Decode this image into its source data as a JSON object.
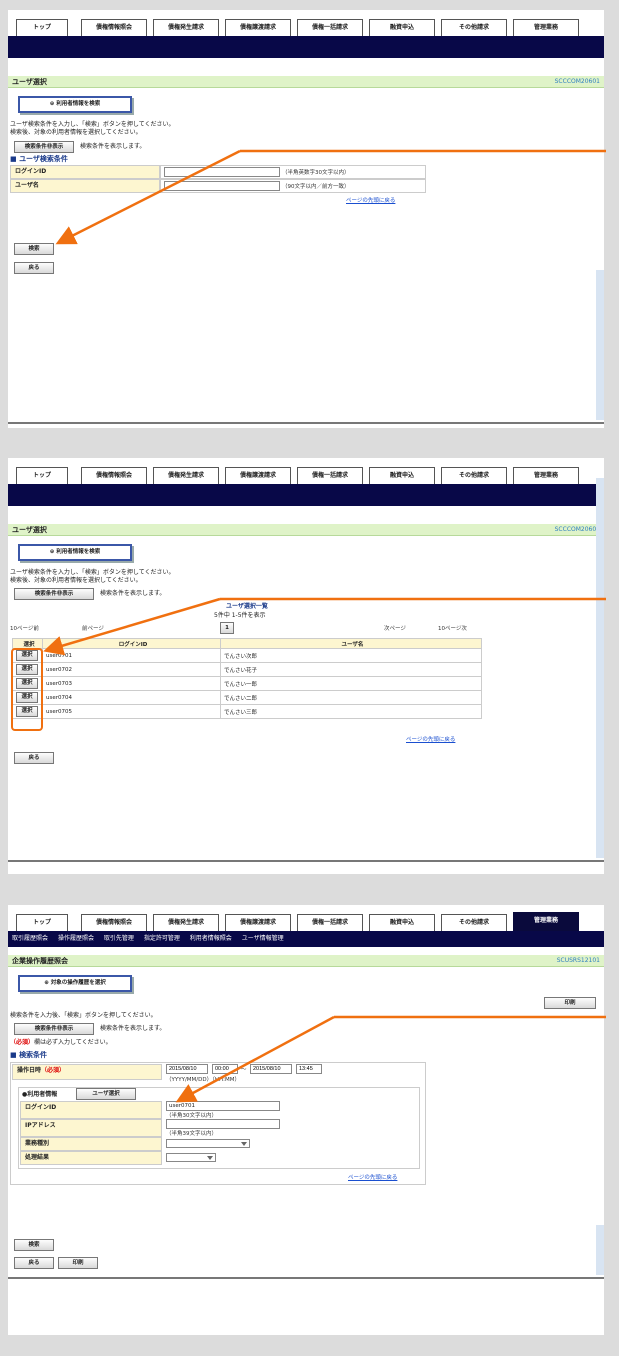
{
  "tabs": [
    "トップ",
    "債権情報照会",
    "債権発生請求",
    "債権譲渡請求",
    "債権一括請求",
    "融資申込",
    "その他請求",
    "管理業務"
  ],
  "panel1": {
    "title": "ユーザ選択",
    "code": "SCCCOM20601",
    "step_label": "⊕ 利用者情報を検索",
    "instruction_1": "ユーザ検索条件を入力し、「検索」ボタンを押してください。",
    "instruction_2": "検索後、対象の利用者情報を選択してください。",
    "toggle_button": "検索条件非表示",
    "toggle_note": "検索条件を表示します。",
    "section": "ユーザ検索条件",
    "login_label": "ログインID",
    "login_hint": "（半角英数字30文字以内）",
    "user_label": "ユーザ名",
    "user_hint": "（90文字以内／前方一致）",
    "top_link": "ページの先頭に戻る",
    "search_button": "検索",
    "back_button": "戻る"
  },
  "panel2": {
    "title": "ユーザ選択",
    "code": "SCCCOM20601",
    "step_label": "⊕ 利用者情報を検索",
    "instruction_1": "ユーザ検索条件を入力し、「検索」ボタンを押してください。",
    "instruction_2": "検索後、対象の利用者情報を選択してください。",
    "toggle_button": "検索条件非表示",
    "toggle_note": "検索条件を表示します。",
    "list_title": "ユーザ選択一覧",
    "count": "5件中 1-5件を表示",
    "prev10": "10ページ前",
    "prev": "前ページ",
    "page": "1",
    "next": "次ページ",
    "next10": "10ページ次",
    "col_select": "選択",
    "col_login": "ログインID",
    "col_user": "ユーザ名",
    "select_label": "選択",
    "rows": [
      {
        "login": "user0701",
        "name": "でんさい次郎"
      },
      {
        "login": "user0702",
        "name": "でんさい花子"
      },
      {
        "login": "user0703",
        "name": "でんさい一郎"
      },
      {
        "login": "user0704",
        "name": "でんさい二郎"
      },
      {
        "login": "user0705",
        "name": "でんさい三郎"
      }
    ],
    "top_link": "ページの先頭に戻る",
    "back_button": "戻る"
  },
  "panel3": {
    "submenu": [
      "取引履歴照会",
      "操作履歴照会",
      "取引先管理",
      "指定許可管理",
      "利用者情報照会",
      "ユーザ情報管理"
    ],
    "title": "企業操作履歴照会",
    "code": "SCUSRS12101",
    "step_label": "⊕ 対象の操作履歴を選択",
    "print_button": "印刷",
    "instruction": "検索条件を入力後、「検索」ボタンを押してください。",
    "toggle_button": "検索条件非表示",
    "toggle_note": "検索条件を表示します。",
    "required_prefix": "（必須）",
    "required_note": "欄は必ず入力してください。",
    "section": "検索条件",
    "datetime_label": "操作日時",
    "required_tag": "（必須）",
    "date_from": "2015/08/10",
    "time_from": "00:00",
    "tilde": "～",
    "date_to": "2015/08/10",
    "time_to": "13:45",
    "datetime_hint": "（YYYY/MM/DD）（HH:MM）",
    "user_info_label": "●利用者情報",
    "user_select_button": "ユーザ選択",
    "login_label": "ログインID",
    "login_value": "user0701",
    "login_hint": "（半角30文字以内）",
    "ip_label": "IPアドレス",
    "ip_hint": "（半角39文字以内）",
    "biz_label": "業務種別",
    "result_label": "処理結果",
    "top_link": "ページの先頭に戻る",
    "search_button": "検索",
    "back_button": "戻る",
    "print_button2": "印刷"
  },
  "colors": {
    "navy": "#080848",
    "title_bg": "#dff3c8",
    "orange": "#f07010",
    "label_bg": "#fdf6d0",
    "code": "#2f7fc0"
  }
}
